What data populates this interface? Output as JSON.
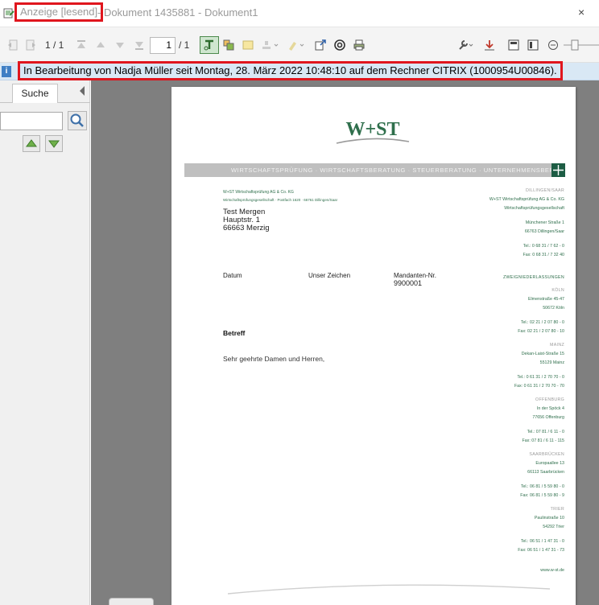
{
  "titlebar": {
    "mode": "Anzeige [lesend]",
    "document": "- Dokument 1435881 - Dokument1",
    "close": "×"
  },
  "toolbar": {
    "page_indicator": "1 / 1",
    "page_input": "1",
    "page_total": "/ 1"
  },
  "infobar": {
    "text": "In Bearbeitung von Nadja Müller seit Montag, 28. März 2022 10:48:10 auf dem Rechner CITRIX (1000954U00846)."
  },
  "leftpanel": {
    "tab_label": "Suche",
    "search_value": ""
  },
  "letter": {
    "logo_text": "W+ST",
    "band_text": "WIRTSCHAFTSPRÜFUNG · WIRTSCHAFTSBERATUNG · STEUERBERATUNG · UNTERNEHMENSBERATUNG",
    "sender_line": "W+ST Wirtschaftsprüfung AG & Co. KG",
    "sender_line2": "Wirtschaftsprüfungsgesellschaft · Postfach 1620 · 66761 Dillingen/Saar",
    "recipient": [
      "Test Mergen",
      "Hauptstr. 1",
      "66663 Merzig"
    ],
    "labels": {
      "datum": "Datum",
      "zeichen": "Unser Zeichen",
      "mandant": "Mandanten-Nr.",
      "mandant_value": "9900001"
    },
    "betreff": "Betreff",
    "anrede": "Sehr geehrte Damen und Herren,",
    "website": "www.w-st.de",
    "offices": [
      {
        "city": "DILLINGEN/SAAR",
        "lines": [
          "W+ST Wirtschaftsprüfung AG & Co. KG",
          "Wirtschaftsprüfungsgesellschaft",
          "",
          "Münchener Straße 1",
          "66763 Dillingen/Saar",
          "",
          "Tel.: 0 68 31 / 7 62 - 0",
          "Fax: 0 68 31 / 7 32 40"
        ]
      },
      {
        "city": "ZWEIGNIEDERLASSUNGEN",
        "lines": []
      },
      {
        "city": "KÖLN",
        "lines": [
          "Elmenstraße 45-47",
          "50672 Köln",
          "",
          "Tel.: 02 21 / 2 07 80 - 0",
          "Fax: 02 21 / 2 07 80 - 10"
        ]
      },
      {
        "city": "MAINZ",
        "lines": [
          "Dekan-Laist-Straße 15",
          "55129 Mainz",
          "",
          "Tel.: 0 61 31 / 2 70 70 - 0",
          "Fax: 0 61 31 / 2 70 70 - 70"
        ]
      },
      {
        "city": "OFFENBURG",
        "lines": [
          "In der Spöck 4",
          "77656 Offenburg",
          "",
          "Tel.: 07 81 / 6 11 - 0",
          "Fax: 07 81 / 6 11 - 115"
        ]
      },
      {
        "city": "SAARBRÜCKEN",
        "lines": [
          "Europaallee 13",
          "66113 Saarbrücken",
          "",
          "Tel.: 06 81 / 5 59 80 - 0",
          "Fax: 06 81 / 5 59 80 - 9"
        ]
      },
      {
        "city": "TRIER",
        "lines": [
          "Paulinstraße 10",
          "54292 Trier",
          "",
          "Tel.: 06 51 / 1 47 31 - 0",
          "Fax: 06 51 / 1 47 31 - 73"
        ]
      }
    ]
  },
  "colors": {
    "highlight": "#e0161e",
    "brand_green": "#2f6f4c",
    "infobar": "#d9e8f5"
  }
}
